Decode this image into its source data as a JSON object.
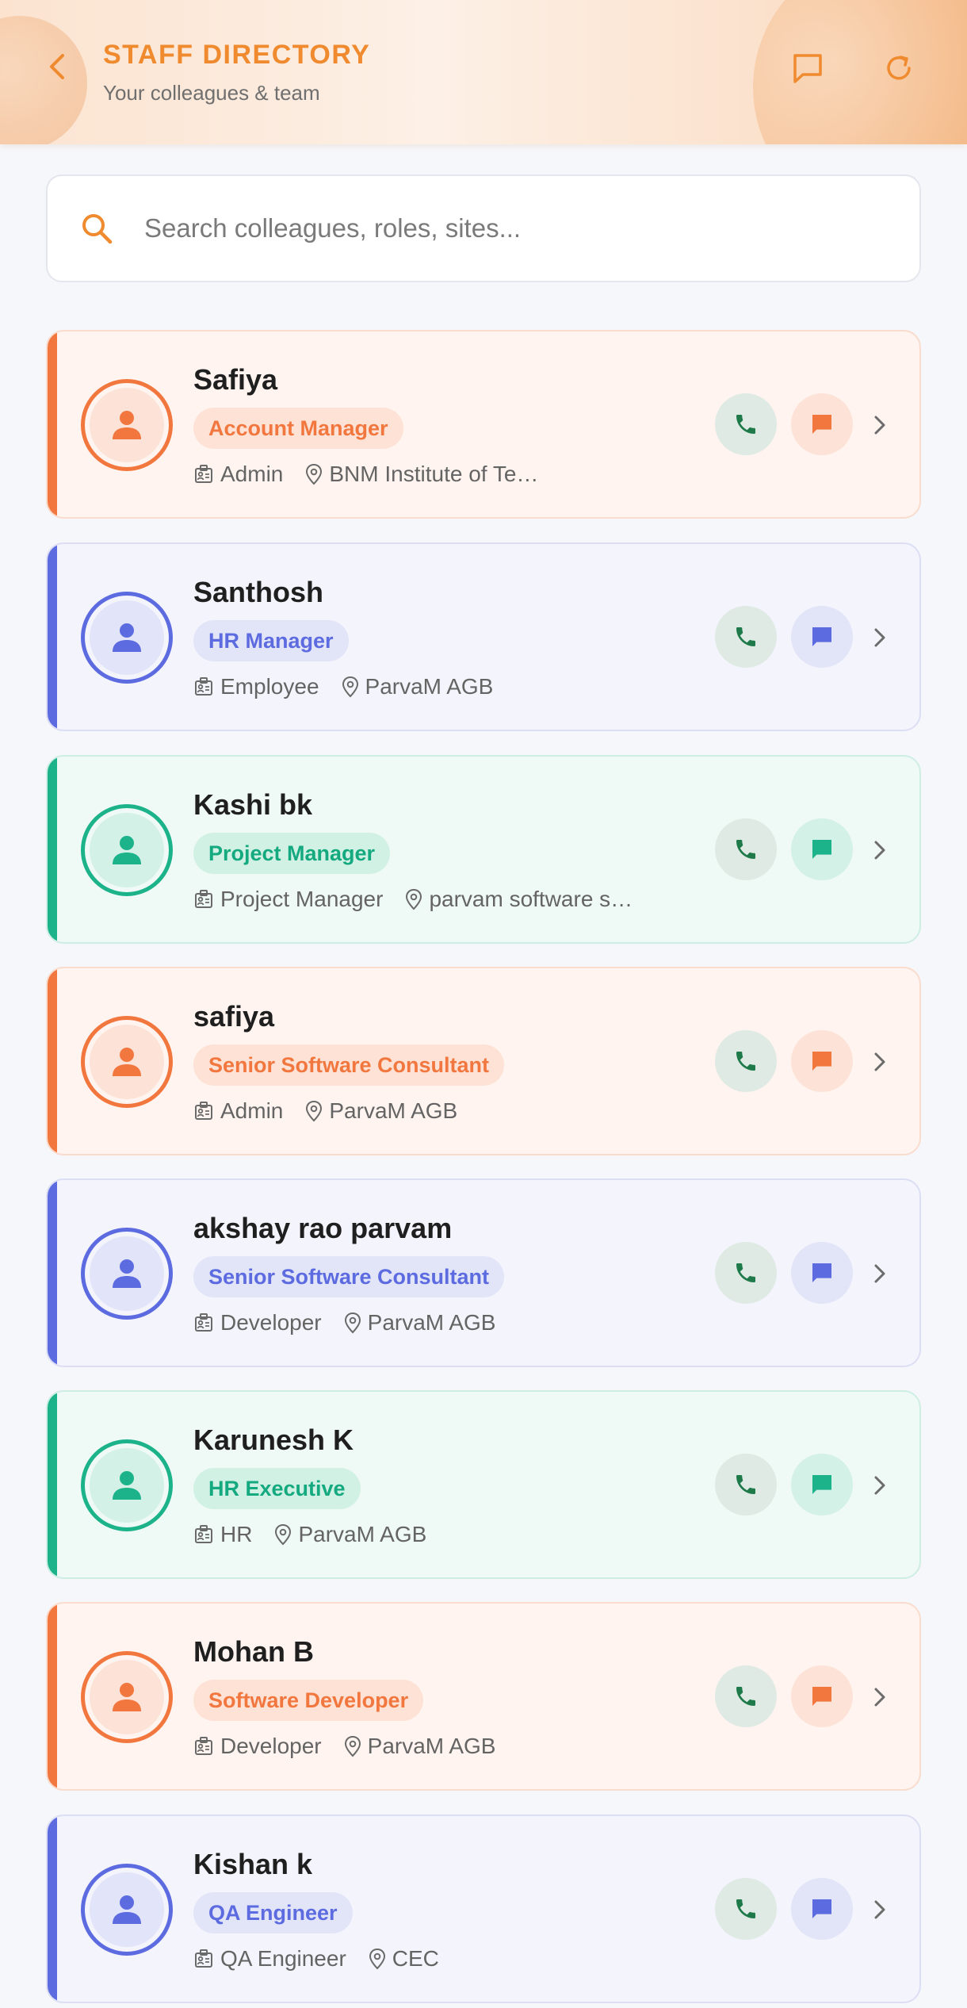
{
  "header": {
    "title": "STAFF DIRECTORY",
    "subtitle": "Your colleagues & team",
    "icons": {
      "back": "back-chevron-icon",
      "messages": "message-square-icon",
      "refresh": "refresh-icon"
    }
  },
  "search": {
    "placeholder": "Search colleagues, roles, sites...",
    "value": "",
    "icon": "search-icon"
  },
  "colors": {
    "accent": "#f08a2e",
    "orange": "#f2773f",
    "indigo": "#5c6be0",
    "teal": "#1db38a",
    "call_green": "#1f7a4a"
  },
  "staff": [
    {
      "name": "Safiya",
      "role": "Account Manager",
      "department": "Admin",
      "location": "BNM Institute of Te…",
      "theme": "orange"
    },
    {
      "name": "Santhosh",
      "role": "HR Manager",
      "department": "Employee",
      "location": "ParvaM AGB",
      "theme": "indigo"
    },
    {
      "name": "Kashi bk",
      "role": "Project Manager",
      "department": "Project Manager",
      "location": "parvam software s…",
      "theme": "teal"
    },
    {
      "name": "safiya",
      "role": "Senior Software Consultant",
      "department": "Admin",
      "location": "ParvaM AGB",
      "theme": "orange"
    },
    {
      "name": "akshay rao parvam",
      "role": "Senior Software Consultant",
      "department": "Developer",
      "location": "ParvaM AGB",
      "theme": "indigo"
    },
    {
      "name": "Karunesh K",
      "role": "HR Executive",
      "department": "HR",
      "location": "ParvaM AGB",
      "theme": "teal"
    },
    {
      "name": "Mohan B",
      "role": "Software Developer",
      "department": "Developer",
      "location": "ParvaM AGB",
      "theme": "orange"
    },
    {
      "name": "Kishan k",
      "role": "QA Engineer",
      "department": "QA Engineer",
      "location": "CEC",
      "theme": "indigo"
    }
  ]
}
